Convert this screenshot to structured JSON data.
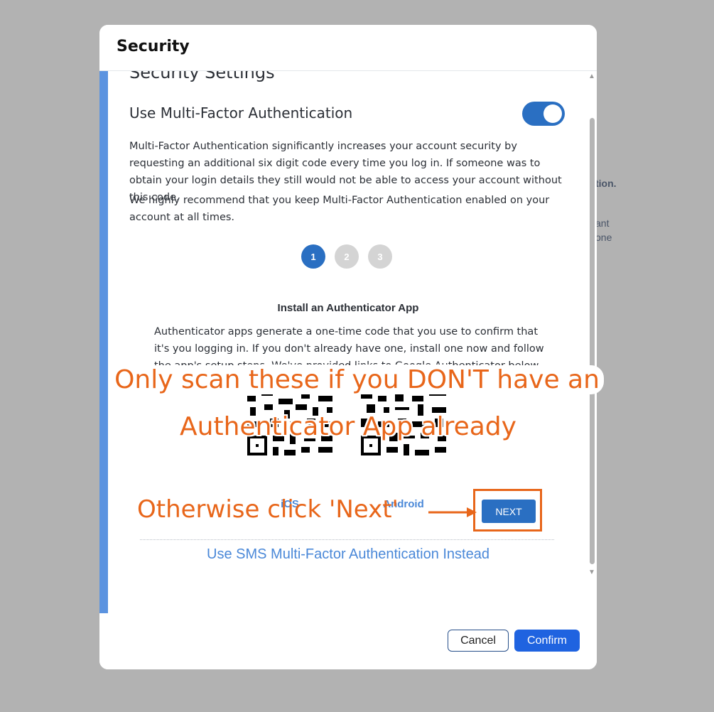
{
  "background": {
    "peek_text_1": "tion.",
    "peek_text_2": "ant",
    "peek_text_3": "one"
  },
  "modal": {
    "title": "Security",
    "section_title": "Security Settings",
    "mfa": {
      "label": "Use Multi-Factor Authentication",
      "enabled": true,
      "description_1": "Multi-Factor Authentication significantly increases your account security by requesting an additional six digit code every time you log in. If someone was to obtain your login details they still would not be able to access your account without this code.",
      "description_2": "We highly recommend that you keep Multi-Factor Authentication enabled on your account at all times."
    },
    "steps": [
      "1",
      "2",
      "3"
    ],
    "active_step": 1,
    "step_title": "Install an Authenticator App",
    "step_instructions": "Authenticator apps generate a one-time code that you use to confirm that it's you logging in. If you don't already have one, install one now and follow the app's setup steps. We've provided links to Google Authenticator below.",
    "qr_codes": [
      {
        "label": "iOS",
        "icon": "qr-code-icon"
      },
      {
        "label": "Android",
        "icon": "qr-code-icon"
      }
    ],
    "next_label": "NEXT",
    "sms_link": "Use SMS Multi-Factor Authentication Instead",
    "footer": {
      "cancel_label": "Cancel",
      "confirm_label": "Confirm"
    }
  },
  "annotations": {
    "line_1": "Only scan these if you DON'T have an",
    "line_2": "Authenticator App already",
    "line_3": "Otherwise click 'Next'"
  },
  "colors": {
    "accent": "#2a6fc2",
    "accent_bar": "#5b93e0",
    "link": "#4a88d8",
    "confirm": "#1f63e0",
    "annotation": "#e8661a",
    "overlay": "#b2b2b2"
  }
}
